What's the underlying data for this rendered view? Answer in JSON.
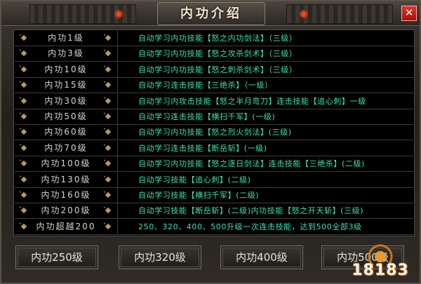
{
  "title": "内功介绍",
  "close_label": "✕",
  "rows": [
    {
      "level": "内功1级",
      "desc": "自动学习内功技能【怒之内功剑法】（三级）"
    },
    {
      "level": "内功3级",
      "desc": "自动学习内功技能【怒之攻杀剑术】（三级）"
    },
    {
      "level": "内功10级",
      "desc": "自动学习内功技能【怒之刺杀剑术】（三级）"
    },
    {
      "level": "内功15级",
      "desc": "自动学习连击技能【三绝杀】（一级）"
    },
    {
      "level": "内功30级",
      "desc": "自动学习内攻击技能【怒之半月弯刀】连击技能【追心刺】一级"
    },
    {
      "level": "内功50级",
      "desc": "自动学习连击技能【横扫千军】(一级)"
    },
    {
      "level": "内功60级",
      "desc": "自动学习内功技能【怒之烈火剑法】(三级)"
    },
    {
      "level": "内功70级",
      "desc": "自动学习连击技能【断岳斩】(一级)"
    },
    {
      "level": "内功100级",
      "desc": "自动学习内功技能【怒之逐日剑法】连击技能【三绝杀】(二级)"
    },
    {
      "level": "内功130级",
      "desc": "自动学习技能【追心刺】(二级)"
    },
    {
      "level": "内功160级",
      "desc": "自动学习技能【横扫千军】(二级)"
    },
    {
      "level": "内功200级",
      "desc": "自动学习技能【断岳斩】(二级)内功技能【怒之开天斩】(三级)"
    },
    {
      "level": "内功超越200",
      "desc": "250、320、400、500升级一次连击技能，达到500全部3级"
    }
  ],
  "buttons": [
    "内功250级",
    "内功320级",
    "内功400级",
    "内功500级"
  ],
  "watermark": "18183",
  "colors": {
    "desc_text": "#3ee0b2",
    "level_text": "#d6d6d0",
    "accent_gold": "#b29a66",
    "close_red": "#d0241a"
  }
}
